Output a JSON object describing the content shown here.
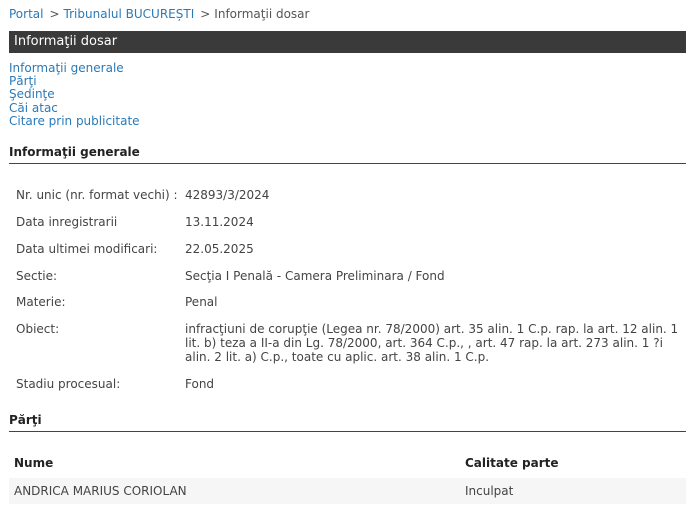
{
  "breadcrumb": {
    "items": [
      "Portal",
      "Tribunalul BUCUREȘTI"
    ],
    "current": "Informaţii dosar",
    "separator": ">"
  },
  "title": "Informaţii dosar",
  "toc": [
    "Informaţii generale",
    "Părţi",
    "Şedinţe",
    "Căi atac",
    "Citare prin publicitate"
  ],
  "general": {
    "heading": "Informaţii generale",
    "rows": [
      {
        "label": "Nr. unic (nr. format vechi) :",
        "value": "42893/3/2024"
      },
      {
        "label": "Data inregistrarii",
        "value": "13.11.2024"
      },
      {
        "label": "Data ultimei modificari:",
        "value": "22.05.2025"
      },
      {
        "label": "Sectie:",
        "value": "Secţia I Penală - Camera Preliminara / Fond"
      },
      {
        "label": "Materie:",
        "value": "Penal"
      },
      {
        "label": "Obiect:",
        "value": "infracţiuni de corupţie (Legea nr. 78/2000) art. 35 alin. 1 C.p. rap. la art. 12 alin. 1 lit. b) teza a II-a din Lg. 78/2000, art. 364 C.p., , art. 47 rap. la art. 273 alin. 1 ?i alin. 2 lit. a) C.p., toate cu aplic. art. 38 alin. 1 C.p."
      },
      {
        "label": "Stadiu procesual:",
        "value": "Fond"
      }
    ]
  },
  "parti": {
    "heading": "Părţi",
    "columns": [
      "Nume",
      "Calitate parte"
    ],
    "rows": [
      {
        "nume": "ANDRICA MARIUS CORIOLAN",
        "calitate": "Inculpat"
      }
    ]
  },
  "colors": {
    "link": "#2a7ab8",
    "titlebar": "#3a3a3a"
  }
}
